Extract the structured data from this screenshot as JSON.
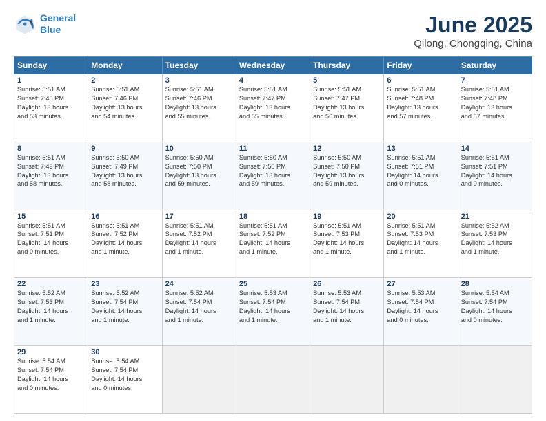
{
  "logo": {
    "line1": "General",
    "line2": "Blue"
  },
  "title": "June 2025",
  "subtitle": "Qilong, Chongqing, China",
  "days_header": [
    "Sunday",
    "Monday",
    "Tuesday",
    "Wednesday",
    "Thursday",
    "Friday",
    "Saturday"
  ],
  "weeks": [
    [
      {
        "day": "1",
        "info": "Sunrise: 5:51 AM\nSunset: 7:45 PM\nDaylight: 13 hours\nand 53 minutes."
      },
      {
        "day": "2",
        "info": "Sunrise: 5:51 AM\nSunset: 7:46 PM\nDaylight: 13 hours\nand 54 minutes."
      },
      {
        "day": "3",
        "info": "Sunrise: 5:51 AM\nSunset: 7:46 PM\nDaylight: 13 hours\nand 55 minutes."
      },
      {
        "day": "4",
        "info": "Sunrise: 5:51 AM\nSunset: 7:47 PM\nDaylight: 13 hours\nand 55 minutes."
      },
      {
        "day": "5",
        "info": "Sunrise: 5:51 AM\nSunset: 7:47 PM\nDaylight: 13 hours\nand 56 minutes."
      },
      {
        "day": "6",
        "info": "Sunrise: 5:51 AM\nSunset: 7:48 PM\nDaylight: 13 hours\nand 57 minutes."
      },
      {
        "day": "7",
        "info": "Sunrise: 5:51 AM\nSunset: 7:48 PM\nDaylight: 13 hours\nand 57 minutes."
      }
    ],
    [
      {
        "day": "8",
        "info": "Sunrise: 5:51 AM\nSunset: 7:49 PM\nDaylight: 13 hours\nand 58 minutes."
      },
      {
        "day": "9",
        "info": "Sunrise: 5:50 AM\nSunset: 7:49 PM\nDaylight: 13 hours\nand 58 minutes."
      },
      {
        "day": "10",
        "info": "Sunrise: 5:50 AM\nSunset: 7:50 PM\nDaylight: 13 hours\nand 59 minutes."
      },
      {
        "day": "11",
        "info": "Sunrise: 5:50 AM\nSunset: 7:50 PM\nDaylight: 13 hours\nand 59 minutes."
      },
      {
        "day": "12",
        "info": "Sunrise: 5:50 AM\nSunset: 7:50 PM\nDaylight: 13 hours\nand 59 minutes."
      },
      {
        "day": "13",
        "info": "Sunrise: 5:51 AM\nSunset: 7:51 PM\nDaylight: 14 hours\nand 0 minutes."
      },
      {
        "day": "14",
        "info": "Sunrise: 5:51 AM\nSunset: 7:51 PM\nDaylight: 14 hours\nand 0 minutes."
      }
    ],
    [
      {
        "day": "15",
        "info": "Sunrise: 5:51 AM\nSunset: 7:51 PM\nDaylight: 14 hours\nand 0 minutes."
      },
      {
        "day": "16",
        "info": "Sunrise: 5:51 AM\nSunset: 7:52 PM\nDaylight: 14 hours\nand 1 minute."
      },
      {
        "day": "17",
        "info": "Sunrise: 5:51 AM\nSunset: 7:52 PM\nDaylight: 14 hours\nand 1 minute."
      },
      {
        "day": "18",
        "info": "Sunrise: 5:51 AM\nSunset: 7:52 PM\nDaylight: 14 hours\nand 1 minute."
      },
      {
        "day": "19",
        "info": "Sunrise: 5:51 AM\nSunset: 7:53 PM\nDaylight: 14 hours\nand 1 minute."
      },
      {
        "day": "20",
        "info": "Sunrise: 5:51 AM\nSunset: 7:53 PM\nDaylight: 14 hours\nand 1 minute."
      },
      {
        "day": "21",
        "info": "Sunrise: 5:52 AM\nSunset: 7:53 PM\nDaylight: 14 hours\nand 1 minute."
      }
    ],
    [
      {
        "day": "22",
        "info": "Sunrise: 5:52 AM\nSunset: 7:53 PM\nDaylight: 14 hours\nand 1 minute."
      },
      {
        "day": "23",
        "info": "Sunrise: 5:52 AM\nSunset: 7:54 PM\nDaylight: 14 hours\nand 1 minute."
      },
      {
        "day": "24",
        "info": "Sunrise: 5:52 AM\nSunset: 7:54 PM\nDaylight: 14 hours\nand 1 minute."
      },
      {
        "day": "25",
        "info": "Sunrise: 5:53 AM\nSunset: 7:54 PM\nDaylight: 14 hours\nand 1 minute."
      },
      {
        "day": "26",
        "info": "Sunrise: 5:53 AM\nSunset: 7:54 PM\nDaylight: 14 hours\nand 1 minute."
      },
      {
        "day": "27",
        "info": "Sunrise: 5:53 AM\nSunset: 7:54 PM\nDaylight: 14 hours\nand 0 minutes."
      },
      {
        "day": "28",
        "info": "Sunrise: 5:54 AM\nSunset: 7:54 PM\nDaylight: 14 hours\nand 0 minutes."
      }
    ],
    [
      {
        "day": "29",
        "info": "Sunrise: 5:54 AM\nSunset: 7:54 PM\nDaylight: 14 hours\nand 0 minutes."
      },
      {
        "day": "30",
        "info": "Sunrise: 5:54 AM\nSunset: 7:54 PM\nDaylight: 14 hours\nand 0 minutes."
      },
      {
        "day": "",
        "info": ""
      },
      {
        "day": "",
        "info": ""
      },
      {
        "day": "",
        "info": ""
      },
      {
        "day": "",
        "info": ""
      },
      {
        "day": "",
        "info": ""
      }
    ]
  ]
}
